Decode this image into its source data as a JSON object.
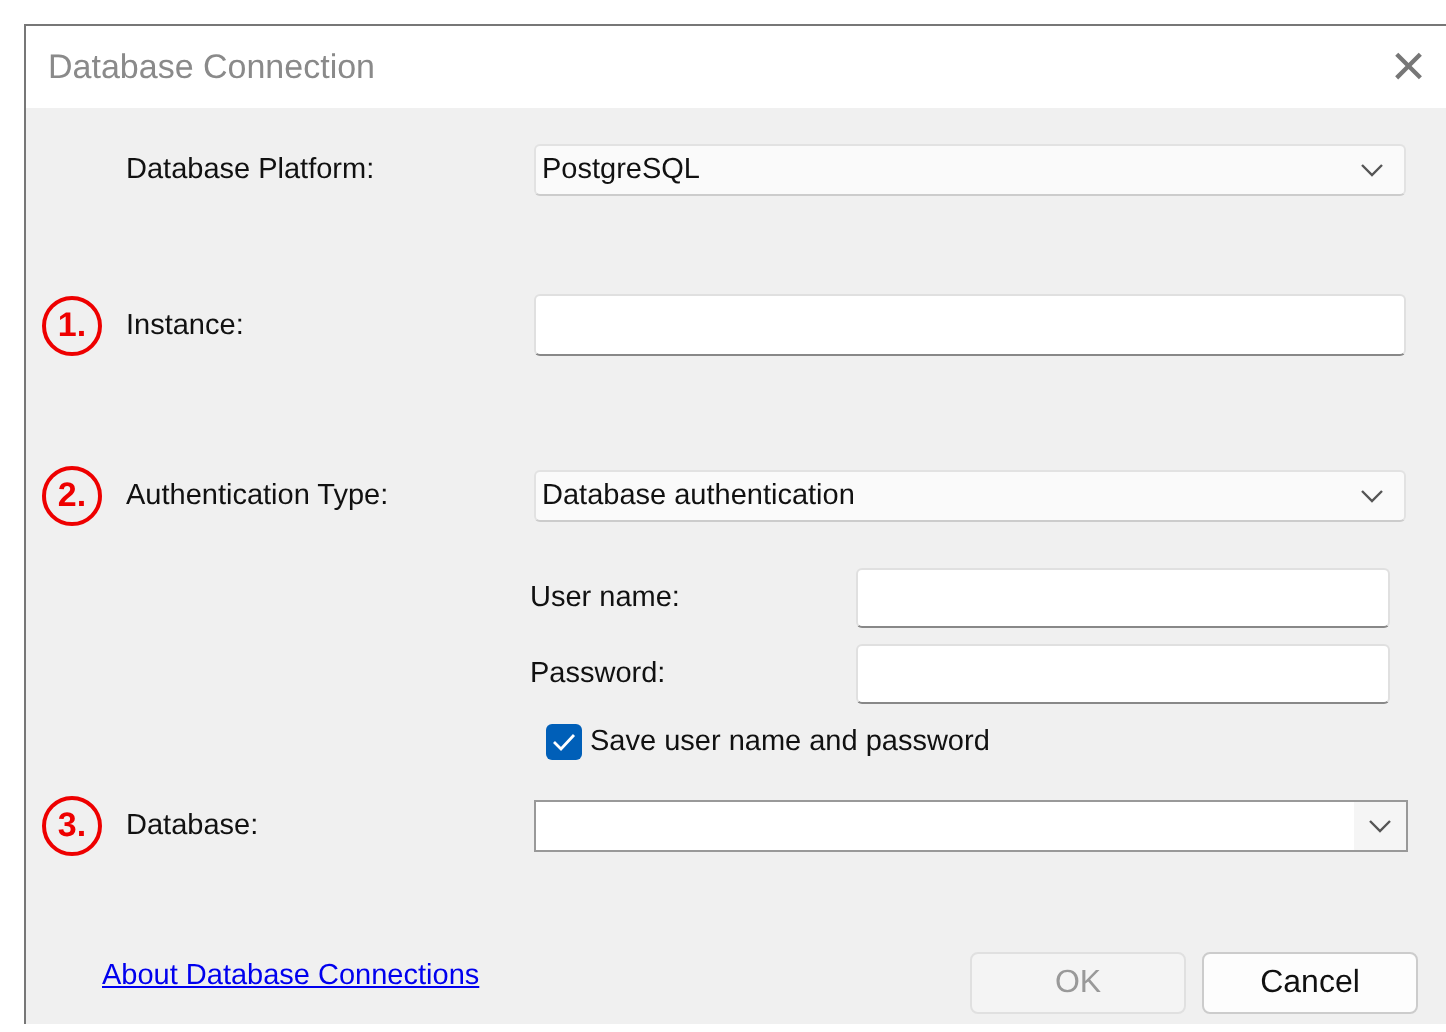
{
  "window": {
    "title": "Database Connection",
    "close": "×"
  },
  "fields": [
    {
      "kind": "dropdown",
      "label": "Database Platform:",
      "value": "PostgreSQL"
    },
    {
      "kind": "text",
      "marker": "1.",
      "label": "Instance:"
    },
    {
      "kind": "dropdown",
      "marker": "2.",
      "label": "Authentication Type:",
      "value": "Database authentication"
    },
    {
      "kind": "subtext",
      "label": "User name:"
    },
    {
      "kind": "subtext",
      "label": "Password:"
    },
    {
      "kind": "checkbox",
      "label": "Save user name and password",
      "checked": true
    },
    {
      "kind": "combo",
      "marker": "3.",
      "label": "Database:"
    }
  ],
  "link": "About Database Connections",
  "buttons": [
    {
      "label": "OK",
      "disabled": true
    },
    {
      "label": "Cancel",
      "disabled": false
    }
  ]
}
